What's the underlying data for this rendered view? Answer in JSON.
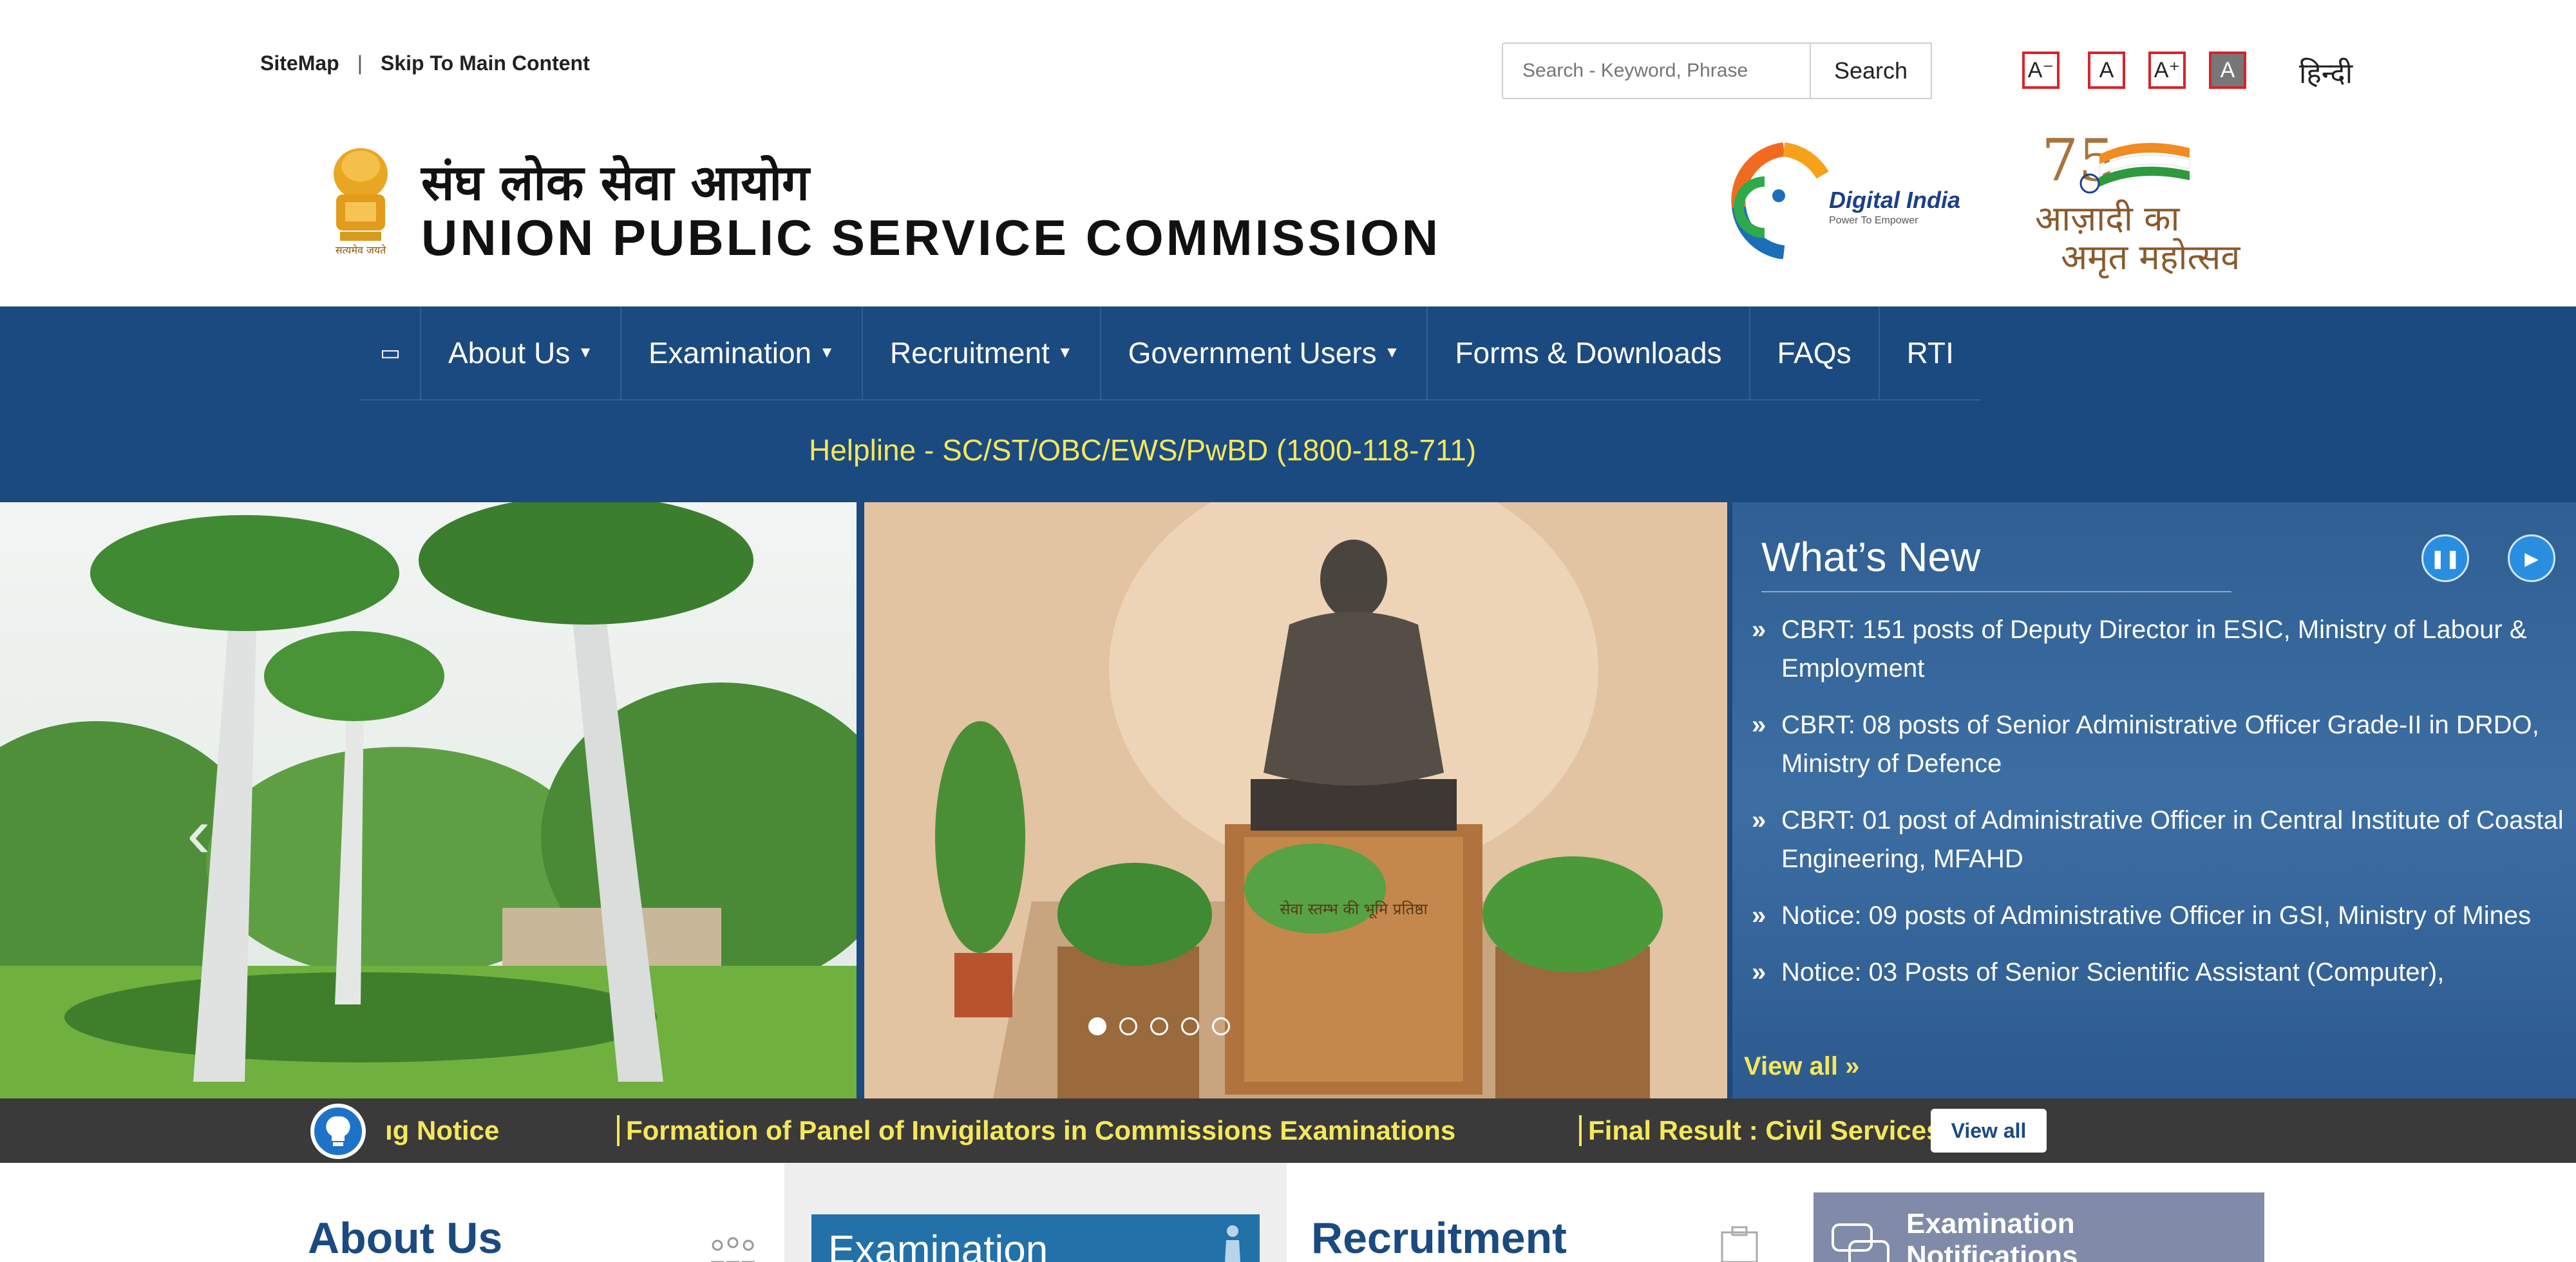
{
  "top_links": {
    "sitemap": "SiteMap",
    "separator": "|",
    "skip": "Skip To Main Content"
  },
  "search": {
    "placeholder": "Search - Keyword, Phrase",
    "button": "Search"
  },
  "font_controls": [
    "A⁻",
    "A",
    "A⁺",
    "A"
  ],
  "language_link": "हिन्दी",
  "header": {
    "title_hindi": "संघ लोक सेवा आयोग",
    "title_english": "UNION PUBLIC SERVICE COMMISSION",
    "digital_india": "Digital India",
    "digital_india_tagline": "Power To Empower",
    "azadi_line1": "आज़ादी का",
    "azadi_line2": "अमृत महोत्सव"
  },
  "nav": {
    "items": [
      {
        "label": "About Us",
        "dropdown": true
      },
      {
        "label": "Examination",
        "dropdown": true
      },
      {
        "label": "Recruitment",
        "dropdown": true
      },
      {
        "label": "Government Users",
        "dropdown": true
      },
      {
        "label": "Forms & Downloads",
        "dropdown": false
      },
      {
        "label": "FAQs",
        "dropdown": false
      },
      {
        "label": "RTI",
        "dropdown": false
      }
    ]
  },
  "helpline": "Helpline - SC/ST/OBC/EWS/PwBD (1800-118-711)",
  "slider": {
    "dots": 5,
    "active_dot": 1,
    "statue_plaque": "सेवा स्तम्भ की भूमि प्रतिष्ठा"
  },
  "whats_new": {
    "title": "What’s New",
    "items": [
      "CBRT: 151 posts of Deputy Director in ESIC, Ministry of Labour & Employment",
      "CBRT: 08 posts of Senior Administrative Officer Grade-II in DRDO, Ministry of Defence",
      "CBRT: 01 post of Administrative Officer in Central Institute of Coastal Engineering, MFAHD",
      "Notice: 09 posts of Administrative Officer in GSI, Ministry of Mines",
      "Notice: 03 Posts of Senior Scientific Assistant (Computer),"
    ],
    "view_all": "View all »"
  },
  "ticker": {
    "label": "ıg Notice",
    "items": [
      "Formation of Panel of Invigilators in Commissions Examinations",
      "Final Result : Civil Services"
    ],
    "view_all": "View all"
  },
  "sections": {
    "about": "About Us",
    "examination": "Examination",
    "recruitment": "Recruitment",
    "notifications_line1": "Examination",
    "notifications_line2": "Notifications"
  },
  "colors": {
    "nav_blue": "#1a4a80",
    "helpline_yellow": "#f5e75a",
    "font_btn_border": "#d8232a",
    "ticker_bg": "#3a3a3a"
  }
}
